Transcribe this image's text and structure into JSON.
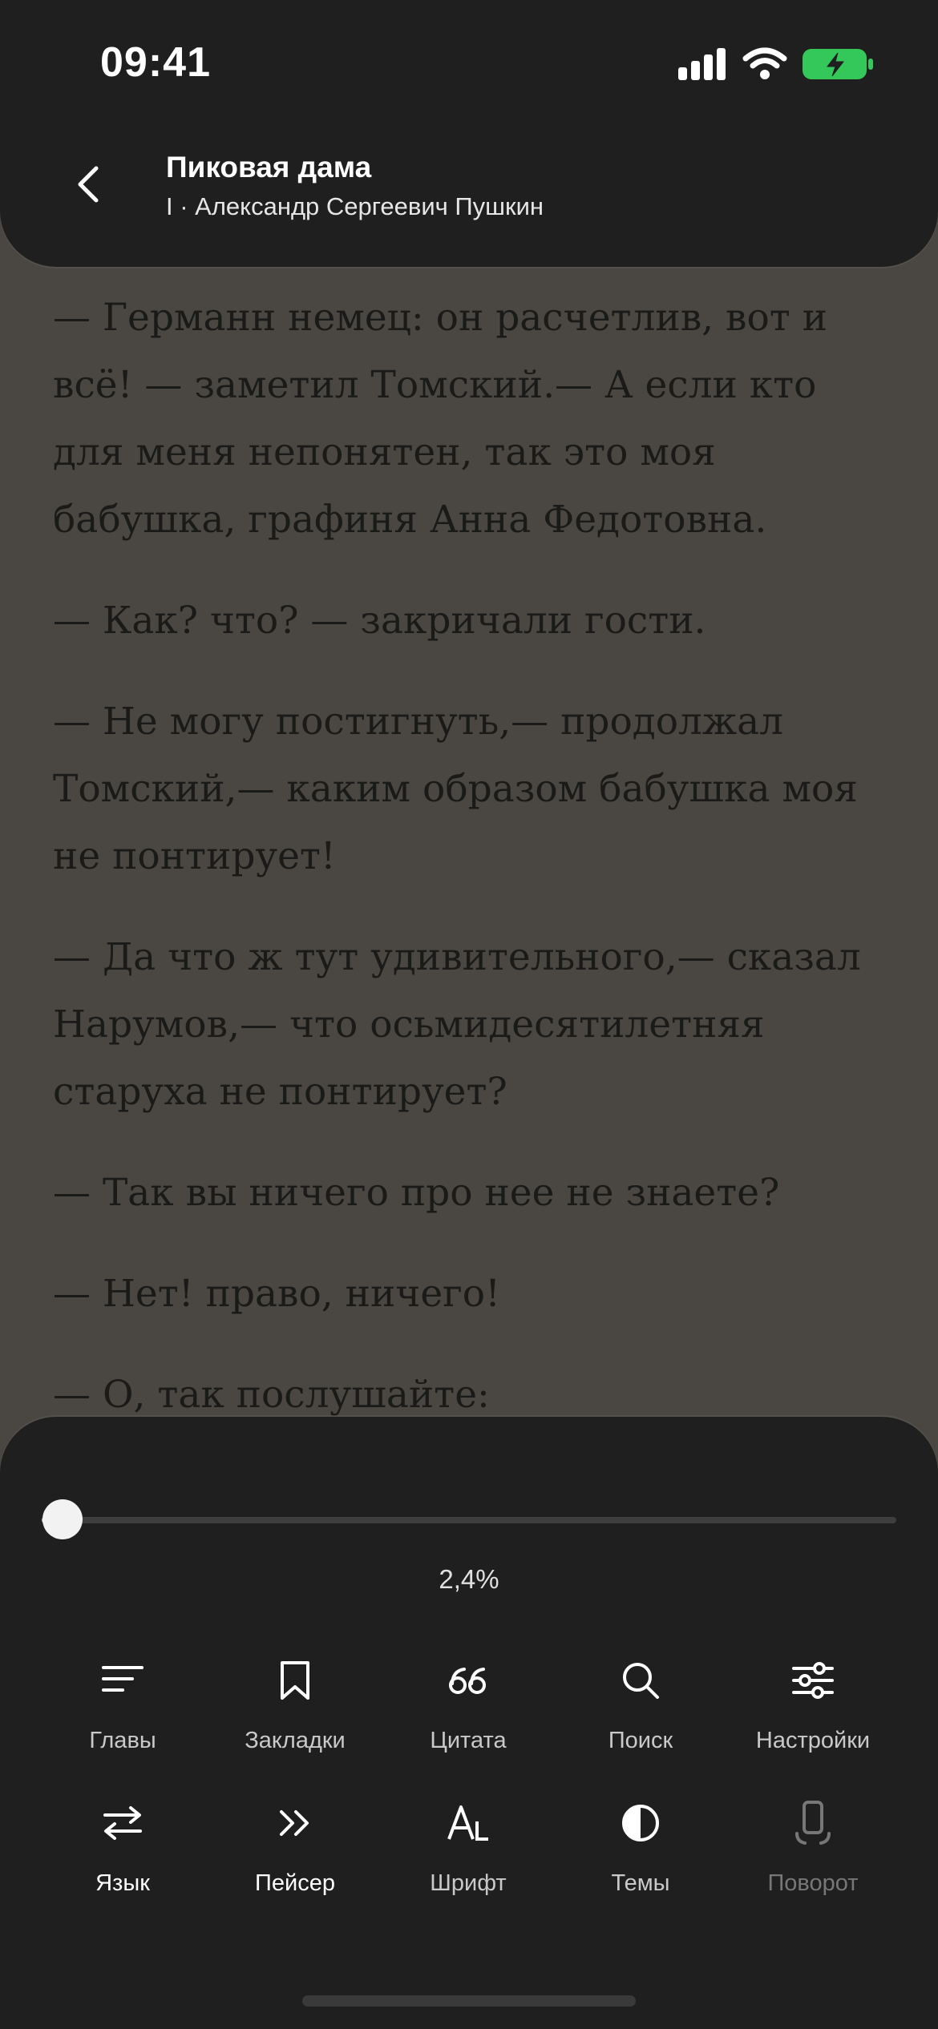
{
  "status_bar": {
    "time": "09:41"
  },
  "header": {
    "title": "Пиковая дама",
    "subtitle": "I · Александр Сергеевич Пушкин"
  },
  "reader": {
    "paragraphs": [
      "— Германн немец: он расчетлив, вот и всё! — заметил Томский.— А если кто для меня непонятен, так это моя бабушка, графиня Анна Федотовна.",
      "— Как? что? — закричали гости.",
      "— Не могу постигнуть,— продолжал Томский,— каким образом бабушка моя не понтирует!",
      "— Да что ж тут удивительного,— сказал Нарумов,— что осьмидесятилетняя старуха не понтирует?",
      "— Так вы ничего про нее не знаете?",
      "— Нет! право, ничего!",
      "— О, так послушайте:"
    ]
  },
  "progress": {
    "label": "2,4%",
    "value": 0.024
  },
  "toolbar": {
    "row1": [
      {
        "label": "Главы",
        "icon": "chapters-icon"
      },
      {
        "label": "Закладки",
        "icon": "bookmark-icon"
      },
      {
        "label": "Цитата",
        "icon": "quote-icon"
      },
      {
        "label": "Поиск",
        "icon": "search-icon"
      },
      {
        "label": "Настройки",
        "icon": "sliders-icon"
      }
    ],
    "row2": [
      {
        "label": "Язык",
        "icon": "swap-arrows-icon"
      },
      {
        "label": "Пейсер",
        "icon": "double-chevron-icon"
      },
      {
        "label": "Шрифт",
        "icon": "font-icon"
      },
      {
        "label": "Темы",
        "icon": "theme-contrast-icon"
      },
      {
        "label": "Поворот",
        "icon": "rotate-phone-icon",
        "disabled": true
      }
    ]
  },
  "colors": {
    "page_bg": "#4a4742",
    "panel_bg": "#1f1f1f",
    "battery": "#34c759"
  }
}
